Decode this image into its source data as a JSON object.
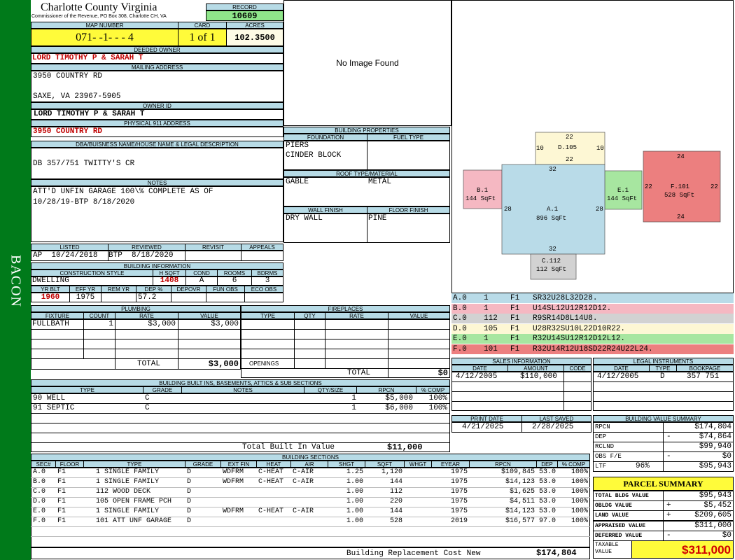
{
  "district": "BACON",
  "county": "Charlotte County Virginia",
  "commissioner": "Commissioner of the Revenue, PO Box 308, Charlotte CH, VA",
  "labels": {
    "record": "RECORD",
    "map_number": "MAP NUMBER",
    "card": "CARD",
    "acres": "ACRES",
    "deeded_owner": "DEEDED OWNER",
    "mailing_address": "MAILING ADDRESS",
    "owner_id": "OWNER ID",
    "physical_address": "PHYSICAL 911 ADDRESS",
    "dba": "DBA/BUISNESS NAME/HOUSE NAME & LEGAL DESCRIPTION",
    "notes": "NOTES",
    "listed": "LISTED",
    "reviewed": "REVIEWED",
    "revisit": "REVISIT",
    "appeals": "APPEALS",
    "building_information": "BUILDING INFORMATION",
    "construction_style": "CONSTRUCTION STYLE",
    "h_sqft": "H SQFT",
    "cond": "COND",
    "rooms": "ROOMS",
    "bdrms": "BDRMS",
    "yr_blt": "YR BLT",
    "eff_yr": "EFF YR",
    "rem_yr": "REM YR",
    "dep_pct": "DEP %",
    "depovr": "DEPOVR",
    "fun_obs": "FUN OBS",
    "eco_obs": "ECO OBS",
    "building_properties": "BUILDING PROPERTIES",
    "foundation": "FOUNDATION",
    "fuel_type": "FUEL TYPE",
    "roof": "ROOF TYPE/MATERIAL",
    "wall_finish": "WALL FINISH",
    "floor_finish": "FLOOR FINISH",
    "plumbing": "PLUMBING",
    "fixture": "FIXTURE",
    "count": "COUNT",
    "rate": "RATE",
    "value": "VALUE",
    "total": "TOTAL",
    "fireplaces": "FIREPLACES",
    "type": "TYPE",
    "qty": "QTY",
    "openings": "OPENINGS",
    "sales_information": "SALES INFORMATION",
    "date": "DATE",
    "amount": "AMOUNT",
    "code": "CODE",
    "legal_instruments": "LEGAL INSTRUMENTS",
    "bookpage": "BOOKPAGE",
    "built_ins": "BUILDING BUILT INS, BASEMENTS, ATTICS & SUB SECTIONS",
    "grade": "GRADE",
    "notes_col": "NOTES",
    "qty_size": "QTY/SIZE",
    "rpcn": "RPCN",
    "pct_comp": "% COMP",
    "total_built_in": "Total Built In Value",
    "print_date": "PRINT DATE",
    "last_saved": "LAST SAVED",
    "building_value_summary": "BUILDING VALUE SUMMARY",
    "building_sections": "BUILDING SECTIONS",
    "parcel_summary": "PARCEL SUMMARY",
    "taxable_value": "TAXABLE VALUE",
    "brcn": "Building Replacement Cost New",
    "no_image": "No Image Found"
  },
  "record": "10609",
  "map_number": "071- -1- - - 4",
  "card": "1 of 1",
  "acres": "102.3500",
  "deeded_owner": "LORD TIMOTHY P & SARAH T",
  "mailing_address": {
    "line1": "3950 COUNTRY RD",
    "line2": "SAXE, VA 23967-5905"
  },
  "owner_id": "LORD TIMOTHY P & SARAH T",
  "physical_address": "3950 COUNTRY RD",
  "dba": "DB 357/751 TWITTY'S CR",
  "notes": {
    "line1": "ATT'D UNFIN GARAGE 100\\% COMPLETE AS OF",
    "line2": "10/28/19-BTP 8/18/2020"
  },
  "listed": "AP  10/24/2018",
  "reviewed": "BTP  8/18/2020",
  "building_info": {
    "style": "DWELLING",
    "hsqft": "1408",
    "cond": "A",
    "rooms": "6",
    "bdrms": "3",
    "yr_blt": "1960",
    "eff_yr": "1975",
    "dep": "57.2"
  },
  "building_properties": {
    "foundation1": "PIERS",
    "foundation2": "CINDER BLOCK",
    "roof1": "GABLE",
    "roof2": "METAL",
    "wall": "DRY WALL",
    "floor": "PINE"
  },
  "plumbing": {
    "fixture": "FULLBATH",
    "count": "1",
    "rate": "$3,000",
    "value": "$3,000",
    "total": "$3,000"
  },
  "fireplaces_total": "$0",
  "sketch": {
    "areas": [
      {
        "id": "A.1",
        "sqft": "896 SqFt",
        "color": "#b9dbe8",
        "dims": [
          "32",
          "28",
          "28",
          "32"
        ]
      },
      {
        "id": "B.1",
        "sqft": "144 SqFt",
        "color": "#f5b8c2",
        "dims": [
          "28"
        ]
      },
      {
        "id": "C.112",
        "sqft": "112 SqFt",
        "color": "#d2d2d2",
        "dims": []
      },
      {
        "id": "D.105",
        "sqft": "",
        "color": "#fdf7d4",
        "dims": [
          "22",
          "10",
          "10",
          "22"
        ]
      },
      {
        "id": "E.1",
        "sqft": "144 SqFt",
        "color": "#a7e6a0",
        "dims": [
          "22"
        ]
      },
      {
        "id": "F.101",
        "sqft": "528 SqFt",
        "color": "#ec7f7f",
        "dims": [
          "24",
          "22",
          "24"
        ]
      }
    ]
  },
  "segments": [
    {
      "sec": "A.0",
      "n": "1",
      "fl": "F1",
      "path": "SR32U28L32D28.",
      "color": "#b9dbe8"
    },
    {
      "sec": "B.0",
      "n": "1",
      "fl": "F1",
      "path": "U14SL12U12R12D12.",
      "color": "#f5b8c2"
    },
    {
      "sec": "C.0",
      "n": "112",
      "fl": "F1",
      "path": "R9SR14D8L14U8.",
      "color": "#d2d2d2"
    },
    {
      "sec": "D.0",
      "n": "105",
      "fl": "F1",
      "path": "U28R32SU10L22D10R22.",
      "color": "#fdf7d4"
    },
    {
      "sec": "E.0",
      "n": "1",
      "fl": "F1",
      "path": "R32U14SU12R12D12L12.",
      "color": "#a7e6a0"
    },
    {
      "sec": "F.0",
      "n": "101",
      "fl": "F1",
      "path": "R32U14R12U18SD22R24U22L24.",
      "color": "#ec7f7f"
    }
  ],
  "sales": {
    "date": "4/12/2005",
    "amount": "$110,000",
    "code": ""
  },
  "legal": {
    "date": "4/12/2005",
    "type": "D",
    "bookpage": "357 751"
  },
  "built_ins": [
    {
      "type": "90 WELL",
      "grade": "C",
      "notes": "",
      "qty": "1",
      "rpcn": "$5,000",
      "comp": "100%"
    },
    {
      "type": "91 SEPTIC",
      "grade": "C",
      "notes": "",
      "qty": "1",
      "rpcn": "$6,000",
      "comp": "100%"
    }
  ],
  "total_built_in_value": "$11,000",
  "print_date": "4/21/2025",
  "last_saved": "2/28/2025",
  "bvs": [
    {
      "label": "RPCN",
      "sign": "",
      "value": "$174,804"
    },
    {
      "label": "DEP",
      "sign": "-",
      "value": "$74,864"
    },
    {
      "label": "RCLND",
      "sign": "",
      "value": "$99,940"
    },
    {
      "label": "OBS F/E",
      "sign": "-",
      "value": "$0"
    },
    {
      "label": "LTF",
      "pct": "96%",
      "sign": "",
      "value": "$95,943"
    }
  ],
  "parcel": [
    {
      "label": "TOTAL BLDG VALUE",
      "sign": "",
      "value": "$95,943"
    },
    {
      "label": "OBLDG VALUE",
      "sign": "+",
      "value": "$5,452"
    },
    {
      "label": "LAND VALUE",
      "sign": "+",
      "value": "$209,605"
    },
    {
      "label": "APPRAISED VALUE",
      "sign": "",
      "value": "$311,000"
    },
    {
      "label": "DEFERRED VALUE",
      "sign": "-",
      "value": "$0"
    }
  ],
  "taxable_value": "$311,000",
  "sections_header": [
    "SEC#",
    "FLOOR",
    "TYPE",
    "GRADE",
    "EXT FIN",
    "HEAT",
    "AIR",
    "SHGT",
    "SQFT",
    "WHGT",
    "EYEAR",
    "RPCN",
    "DEP",
    "% COMP"
  ],
  "sections": [
    [
      "A.0",
      "F1",
      "1 SINGLE FAMILY",
      "D",
      "WDFRM",
      "C-HEAT",
      "C-AIR",
      "1.25",
      "1,120",
      "",
      "1975",
      "$109,845",
      "53.0",
      "100%"
    ],
    [
      "B.0",
      "F1",
      "1 SINGLE FAMILY",
      "D",
      "WDFRM",
      "C-HEAT",
      "C-AIR",
      "1.00",
      "144",
      "",
      "1975",
      "$14,123",
      "53.0",
      "100%"
    ],
    [
      "C.0",
      "F1",
      "112 WOOD DECK",
      "D",
      "",
      "",
      "",
      "1.00",
      "112",
      "",
      "1975",
      "$1,625",
      "53.0",
      "100%"
    ],
    [
      "D.0",
      "F1",
      "105 OPEN FRAME PCH",
      "D",
      "",
      "",
      "",
      "1.00",
      "220",
      "",
      "1975",
      "$4,511",
      "53.0",
      "100%"
    ],
    [
      "E.0",
      "F1",
      "1 SINGLE FAMILY",
      "D",
      "WDFRM",
      "C-HEAT",
      "C-AIR",
      "1.00",
      "144",
      "",
      "1975",
      "$14,123",
      "53.0",
      "100%"
    ],
    [
      "F.0",
      "F1",
      "101 ATT UNF GARAGE",
      "D",
      "",
      "",
      "",
      "1.00",
      "528",
      "",
      "2019",
      "$16,577",
      "97.0",
      "100%"
    ]
  ],
  "brcn_value": "$174,804"
}
